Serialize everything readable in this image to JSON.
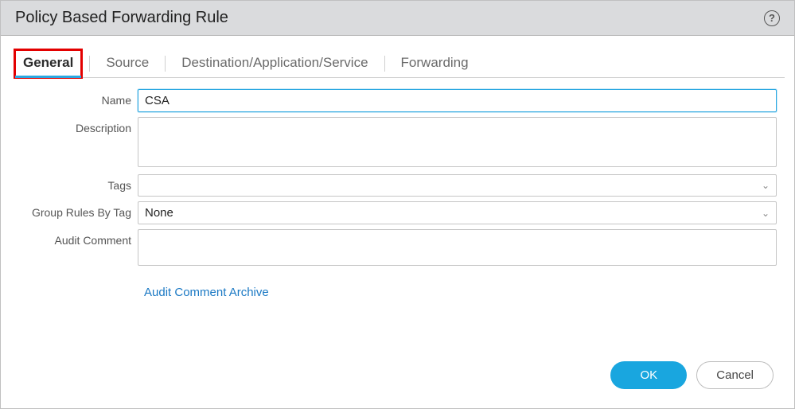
{
  "dialog": {
    "title": "Policy Based Forwarding Rule"
  },
  "tabs": [
    {
      "label": "General",
      "active": true
    },
    {
      "label": "Source",
      "active": false
    },
    {
      "label": "Destination/Application/Service",
      "active": false
    },
    {
      "label": "Forwarding",
      "active": false
    }
  ],
  "form": {
    "name_label": "Name",
    "name_value": "CSA",
    "description_label": "Description",
    "description_value": "",
    "tags_label": "Tags",
    "tags_value": "",
    "group_rules_label": "Group Rules By Tag",
    "group_rules_value": "None",
    "audit_comment_label": "Audit Comment",
    "audit_comment_value": "",
    "audit_archive_link": "Audit Comment Archive"
  },
  "buttons": {
    "ok": "OK",
    "cancel": "Cancel"
  }
}
